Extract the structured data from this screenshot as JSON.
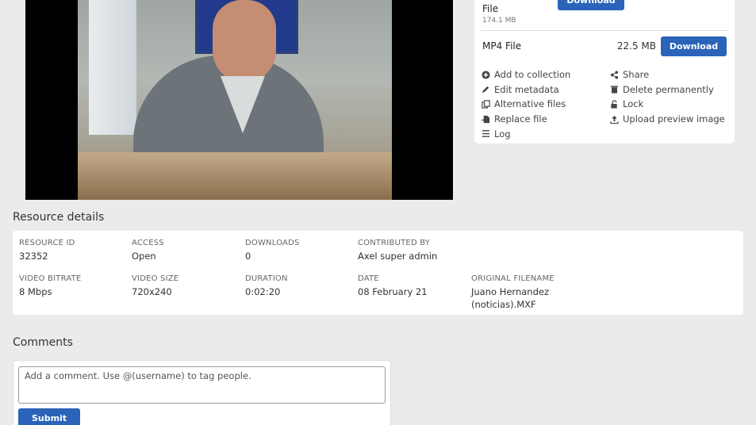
{
  "files": {
    "first": {
      "name": "File",
      "size": "174.1 MB",
      "download_label": "Download"
    },
    "mp4": {
      "name": "MP4 File",
      "size": "22.5 MB",
      "download_label": "Download"
    }
  },
  "actions": {
    "left": [
      {
        "label": "Add to collection",
        "icon": "plus-circle-icon"
      },
      {
        "label": "Edit metadata",
        "icon": "pencil-icon"
      },
      {
        "label": "Alternative files",
        "icon": "copy-icon"
      },
      {
        "label": "Replace file",
        "icon": "replace-file-icon"
      },
      {
        "label": "Log",
        "icon": "list-icon"
      }
    ],
    "right": [
      {
        "label": "Share",
        "icon": "share-icon"
      },
      {
        "label": "Delete permanently",
        "icon": "trash-icon"
      },
      {
        "label": "Lock",
        "icon": "lock-open-icon"
      },
      {
        "label": "Upload preview image",
        "icon": "upload-icon"
      }
    ]
  },
  "resource_details": {
    "title": "Resource details",
    "fields": {
      "resource_id": {
        "label": "RESOURCE ID",
        "value": "32352"
      },
      "access": {
        "label": "ACCESS",
        "value": "Open"
      },
      "downloads": {
        "label": "DOWNLOADS",
        "value": "0"
      },
      "contributed_by": {
        "label": "CONTRIBUTED BY",
        "value": "Axel super admin"
      },
      "video_bitrate": {
        "label": "VIDEO BITRATE",
        "value": "8 Mbps"
      },
      "video_size": {
        "label": "VIDEO SIZE",
        "value": "720x240"
      },
      "duration": {
        "label": "DURATION",
        "value": "0:02:20"
      },
      "date": {
        "label": "DATE",
        "value": "08 February 21"
      },
      "original_filename": {
        "label": "ORIGINAL FILENAME",
        "value": "Juano Hernandez (noticias).MXF"
      }
    }
  },
  "comments": {
    "title": "Comments",
    "placeholder": "Add a comment. Use @(username) to tag people.",
    "submit_label": "Submit"
  },
  "colors": {
    "primary": "#2a63b8",
    "background": "#ebebeb"
  }
}
